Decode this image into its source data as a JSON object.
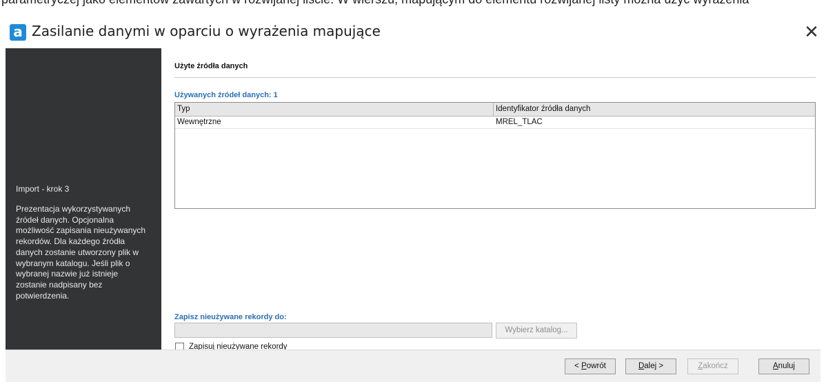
{
  "top_strip": {
    "text": "parametryczej jako elementów zawartych w rozwijanej liście. W wierszu, mapującym do elementu rozwijanej listy można użyć wyrażenia"
  },
  "window": {
    "icon_letter": "a",
    "title": "Zasilanie danymi w oparciu o wyrażenia mapujące",
    "close_glyph": "✕"
  },
  "sidebar": {
    "step": "Import - krok 3",
    "description": "Prezentacja wykorzystywanych źródeł danych. Opcjonalna możliwość zapisania nieużywanych rekordów. Dla każdego źródła danych zostanie utworzony plik w wybranym katalogu. Jeśli plik o wybranej nazwie już istnieje zostanie nadpisany bez potwierdzenia."
  },
  "main": {
    "section_title": "Użyte źródła danych",
    "count_label": "Używanych źródeł danych: 1",
    "table": {
      "columns": [
        "Typ",
        "Identyfikator źródła danych"
      ],
      "rows": [
        [
          "Wewnętrzne",
          "MREL_TLAC"
        ]
      ]
    },
    "save_label": "Zapisz nieużywane rekordy do:",
    "path_value": "",
    "choose_folder": "Wybierz katalog...",
    "checkbox_label": "Zapisuj nieużywane rekordy",
    "checkbox_checked": false
  },
  "footer": {
    "back": {
      "prefix": "< ",
      "key": "P",
      "rest": "owrót"
    },
    "next": {
      "key": "D",
      "rest": "alej >"
    },
    "finish": {
      "key": "Z",
      "rest": "akończ"
    },
    "cancel": {
      "key": "A",
      "rest": "nuluj"
    }
  },
  "colors": {
    "sidebar_bg": "#333436",
    "accent_blue": "#2b6fb5",
    "icon_blue": "#1e8bd6"
  }
}
